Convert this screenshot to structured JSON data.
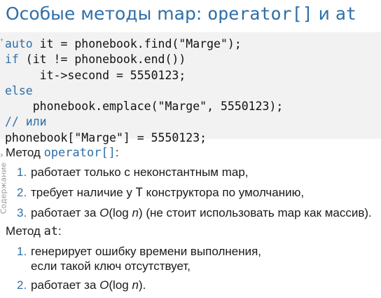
{
  "title": {
    "prefix": "Особые методы map: ",
    "op": "operator[]",
    "mid": " и ",
    "at": "at"
  },
  "code": {
    "line1_kw": "auto",
    "line1_rest": " it = phonebook.find(\"Marge\");",
    "line2_kw": "if",
    "line2_rest": " (it != phonebook.end())",
    "line3": "     it->second = 5550123;",
    "line4_kw": "else",
    "line5": "    phonebook.emplace(\"Marge\", 5550123);",
    "line6_comment": "// или",
    "line7": "phonebook[\"Marge\"] = 5550123;"
  },
  "sidebar": {
    "chevron": "›",
    "label": "Содержание"
  },
  "section1": {
    "prefix": "Метод ",
    "mono": "operator[]",
    "suffix": ":",
    "items": [
      {
        "num": "1.",
        "text": "работает только с неконстантным map,"
      },
      {
        "num": "2.",
        "text_a": "требует наличие у ",
        "text_t": "T",
        "text_b": " конструктора по умолчанию,"
      },
      {
        "num": "3.",
        "text_a": "работает за ",
        "text_o": "O",
        "text_b": "(log ",
        "text_n": "n",
        "text_c": ") (не стоит использовать map как массив)."
      }
    ]
  },
  "section2": {
    "prefix": "Метод ",
    "mono": "at",
    "suffix": ":",
    "items": [
      {
        "num": "1.",
        "line1": "генерирует ошибку времени выполнения,",
        "line2": "если такой ключ отсутствует,"
      },
      {
        "num": "2.",
        "text_a": "работает за ",
        "text_o": "O",
        "text_b": "(log ",
        "text_n": "n",
        "text_c": ")."
      }
    ]
  },
  "colors": {
    "accent": "#2f6fa7",
    "code_bg": "#f2f2f2"
  }
}
